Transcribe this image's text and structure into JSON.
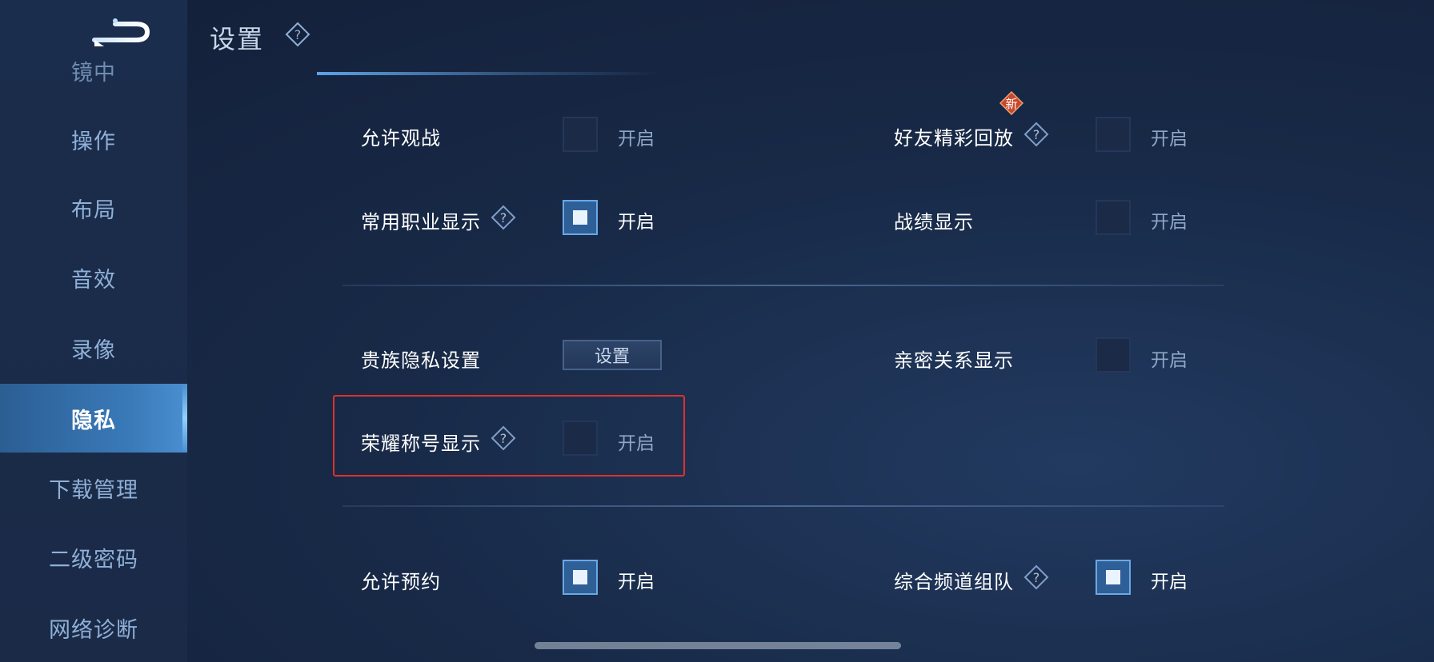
{
  "header": {
    "title": "设置"
  },
  "sidebar": {
    "items": [
      {
        "label": "镜中",
        "state": "partial"
      },
      {
        "label": "操作",
        "state": "normal"
      },
      {
        "label": "布局",
        "state": "normal"
      },
      {
        "label": "音效",
        "state": "normal"
      },
      {
        "label": "录像",
        "state": "normal"
      },
      {
        "label": "隐私",
        "state": "active"
      },
      {
        "label": "下载管理",
        "state": "normal"
      },
      {
        "label": "二级密码",
        "state": "normal"
      },
      {
        "label": "网络诊断",
        "state": "normal"
      }
    ]
  },
  "settings": {
    "allow_spectate": {
      "label": "允许观战",
      "option": "开启",
      "checked": false
    },
    "friend_replay": {
      "label": "好友精彩回放",
      "option": "开启",
      "checked": false,
      "badge": "新"
    },
    "common_role": {
      "label": "常用职业显示",
      "option": "开启",
      "checked": true
    },
    "record_display": {
      "label": "战绩显示",
      "option": "开启",
      "checked": false
    },
    "noble_privacy": {
      "label": "贵族隐私设置",
      "button": "设置"
    },
    "intimate_display": {
      "label": "亲密关系显示",
      "option": "开启",
      "checked": false
    },
    "honor_title": {
      "label": "荣耀称号显示",
      "option": "开启",
      "checked": false
    },
    "allow_booking": {
      "label": "允许预约",
      "option": "开启",
      "checked": true
    },
    "channel_team": {
      "label": "综合频道组队",
      "option": "开启",
      "checked": true
    }
  },
  "colors": {
    "highlight": "#e0302a",
    "active_tab": "#3a7ab9",
    "checkbox_checked": "#2f5f97"
  }
}
